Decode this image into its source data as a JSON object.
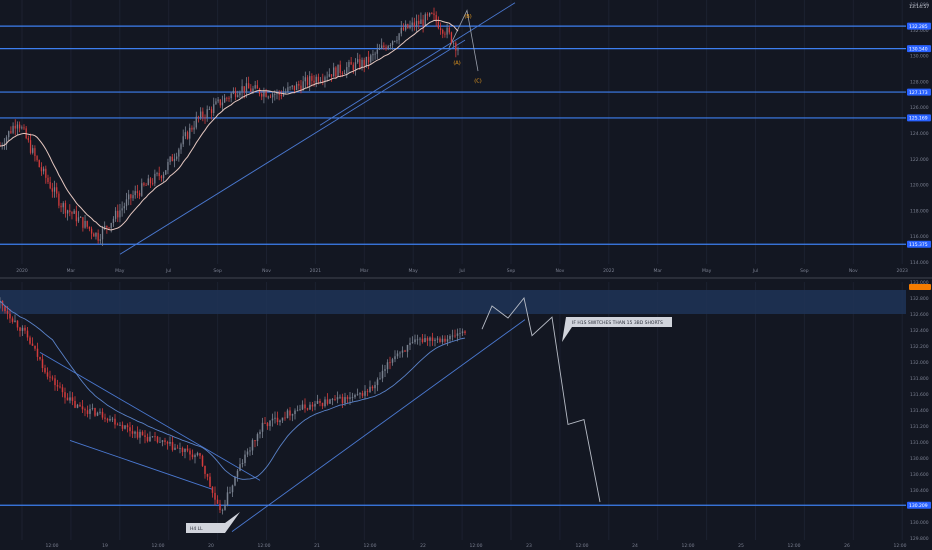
{
  "colors": {
    "background": "#131722",
    "up_candle": "#7a8290",
    "down_candle": "#d43c3c",
    "level_line": "#3d7ff0",
    "trendline": "#4a78d0",
    "ma_top": "#e5c7c0",
    "ma_bottom": "#5a82c8",
    "zone_fill": "#1e3457",
    "projection": "#b7bcc6",
    "wave_label": "#f0a020",
    "axis_text": "#7b8091",
    "price_label_bg": "#2962ff",
    "price_label_text": "#ffffff",
    "current_price_bg": "#f57c00",
    "callout_bg": "#d1d4dc",
    "callout_text": "#2a2e39"
  },
  "top_panel": {
    "axis_prices": [
      "134.000",
      "132.000",
      "130.000",
      "128.000",
      "126.000",
      "124.000",
      "122.000",
      "120.000",
      "118.000",
      "116.000",
      "114.000"
    ],
    "level_labels": [
      "132.285",
      "130.540",
      "127.173",
      "125.169",
      "115.375"
    ],
    "time_labels": [
      "2020",
      "Mar",
      "May",
      "Jul",
      "Sep",
      "Nov",
      "2021",
      "Mar",
      "May",
      "Jul",
      "Sep",
      "Nov",
      "2022",
      "Mar",
      "May",
      "Jul",
      "Sep",
      "Nov",
      "2023"
    ],
    "wave_labels": [
      "(B)",
      "(A)",
      "(C)"
    ],
    "timer": "13:14:57"
  },
  "bottom_panel": {
    "axis_prices": [
      "133.000",
      "132.800",
      "132.600",
      "132.400",
      "132.200",
      "132.000",
      "131.800",
      "131.600",
      "131.400",
      "131.200",
      "131.000",
      "130.800",
      "130.600",
      "130.400",
      "130.200",
      "130.000",
      "129.800"
    ],
    "level_label": "130.209",
    "current_price": "132.3",
    "time_labels": [
      "12:00",
      "19",
      "12:00",
      "20",
      "12:00",
      "21",
      "12:00",
      "22",
      "12:00",
      "23",
      "12:00",
      "24",
      "12:00",
      "25",
      "12:00",
      "26",
      "12:00",
      "29"
    ],
    "callouts": [
      "IF H1S SWITCHES THAN 15 3BD SHORTS",
      "H4 LL"
    ]
  },
  "chart_data": [
    {
      "type": "candlestick",
      "x_range": [
        "2020-01",
        "2023-01"
      ],
      "ylim": [
        114,
        134
      ],
      "path": [
        [
          0,
          123
        ],
        [
          8,
          125
        ],
        [
          18,
          121.4
        ],
        [
          28,
          118.5
        ],
        [
          45,
          116
        ],
        [
          60,
          119
        ],
        [
          75,
          121
        ],
        [
          90,
          125
        ],
        [
          110,
          127.5
        ],
        [
          128,
          127
        ],
        [
          148,
          128.5
        ],
        [
          168,
          129.5
        ],
        [
          185,
          132
        ],
        [
          198,
          133
        ],
        [
          205,
          131.8
        ],
        [
          210,
          130.6
        ]
      ],
      "horizontal_levels": [
        132.285,
        130.54,
        127.173,
        125.169,
        115.375
      ]
    },
    {
      "type": "candlestick",
      "ylim": [
        129.8,
        133
      ],
      "path": [
        [
          0,
          132.74
        ],
        [
          10,
          132.35
        ],
        [
          20,
          131.8
        ],
        [
          30,
          131.45
        ],
        [
          42,
          131.33
        ],
        [
          55,
          131.1
        ],
        [
          68,
          130.95
        ],
        [
          80,
          130.8
        ],
        [
          88,
          130.1
        ],
        [
          96,
          130.7
        ],
        [
          105,
          131.2
        ],
        [
          118,
          131.4
        ],
        [
          130,
          131.5
        ],
        [
          142,
          131.55
        ],
        [
          150,
          131.7
        ],
        [
          158,
          132.1
        ],
        [
          170,
          132.3
        ],
        [
          180,
          132.3
        ],
        [
          186,
          132.4
        ]
      ],
      "zone": [
        132.6,
        132.9
      ],
      "horizontal_levels": [
        130.209
      ],
      "projection": [
        132.41,
        132.7,
        132.55,
        132.8,
        132.33,
        132.56,
        131.22,
        131.28,
        130.25
      ]
    }
  ]
}
